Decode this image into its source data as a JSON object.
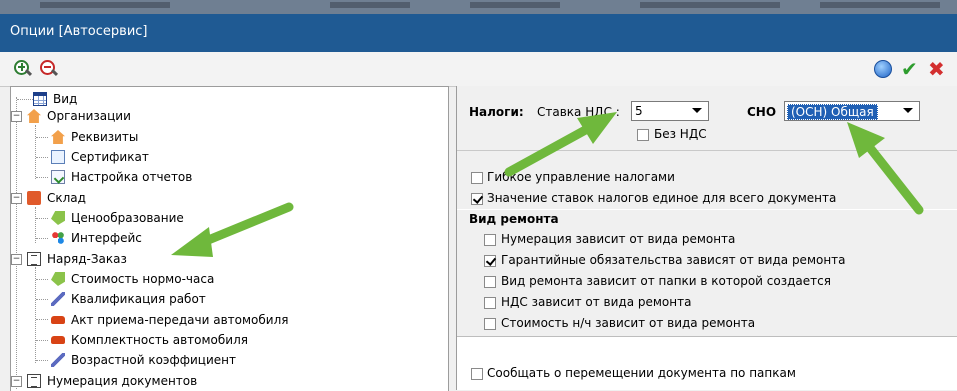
{
  "window": {
    "title": "Опции [Автосервис]"
  },
  "toolbar": {
    "zoom_in": "zoom-in-icon",
    "zoom_out": "zoom-out-icon",
    "help": "help-icon",
    "ok": "✔",
    "cancel": "✖"
  },
  "tree": {
    "items": [
      {
        "label": "Вид",
        "icon": "grid-icon"
      },
      {
        "label": "Организации",
        "icon": "house-icon",
        "expanded": true
      },
      {
        "label": "Реквизиты",
        "icon": "house-icon"
      },
      {
        "label": "Сертификат",
        "icon": "document-icon"
      },
      {
        "label": "Настройка отчетов",
        "icon": "report-icon"
      },
      {
        "label": "Склад",
        "icon": "box-icon",
        "expanded": true
      },
      {
        "label": "Ценообразование",
        "icon": "tag-icon"
      },
      {
        "label": "Интерфейс",
        "icon": "puzzle-icon"
      },
      {
        "label": "Наряд-Заказ",
        "icon": "book-icon",
        "expanded": true
      },
      {
        "label": "Стоимость нормо-часа",
        "icon": "tag-icon"
      },
      {
        "label": "Квалификация работ",
        "icon": "wrench-icon"
      },
      {
        "label": "Акт приема-передачи автомобиля",
        "icon": "car-icon"
      },
      {
        "label": "Комплектность автомобиля",
        "icon": "car-icon"
      },
      {
        "label": "Возрастной коэффициент",
        "icon": "wrench-icon"
      },
      {
        "label": "Нумерация документов",
        "icon": "book-icon",
        "expanded": true
      }
    ],
    "expander_minus": "−"
  },
  "taxes": {
    "label": "Налоги:",
    "vat_rate_label": "Ставка НДС :",
    "vat_rate_value": "5",
    "no_vat_label": "Без НДС",
    "sno_label": "СНО",
    "sno_value": "(ОСН) Общая"
  },
  "options": {
    "flexible_taxes": {
      "label": "Гибкое управление налогами",
      "checked": false
    },
    "single_tax_rate": {
      "label": "Значение ставок налогов единое для всего документа",
      "checked": true
    }
  },
  "repair_type": {
    "heading": "Вид ремонта",
    "items": [
      {
        "label": "Нумерация зависит от вида ремонта",
        "checked": false
      },
      {
        "label": "Гарантийные обязательства зависят от вида ремонта",
        "checked": true
      },
      {
        "label": "Вид ремонта зависит от папки в которой создается",
        "checked": false
      },
      {
        "label": "НДС зависит от вида ремонта",
        "checked": false
      },
      {
        "label": "Стоимость н/ч зависит от вида ремонта",
        "checked": false
      }
    ]
  },
  "extra": {
    "notify_move": {
      "label": "Сообщать о перемещении документа по папкам",
      "checked": false
    }
  },
  "colors": {
    "titlebar": "#1f5a93",
    "arrow": "#6fb83c",
    "selection": "#1f5fb4"
  }
}
